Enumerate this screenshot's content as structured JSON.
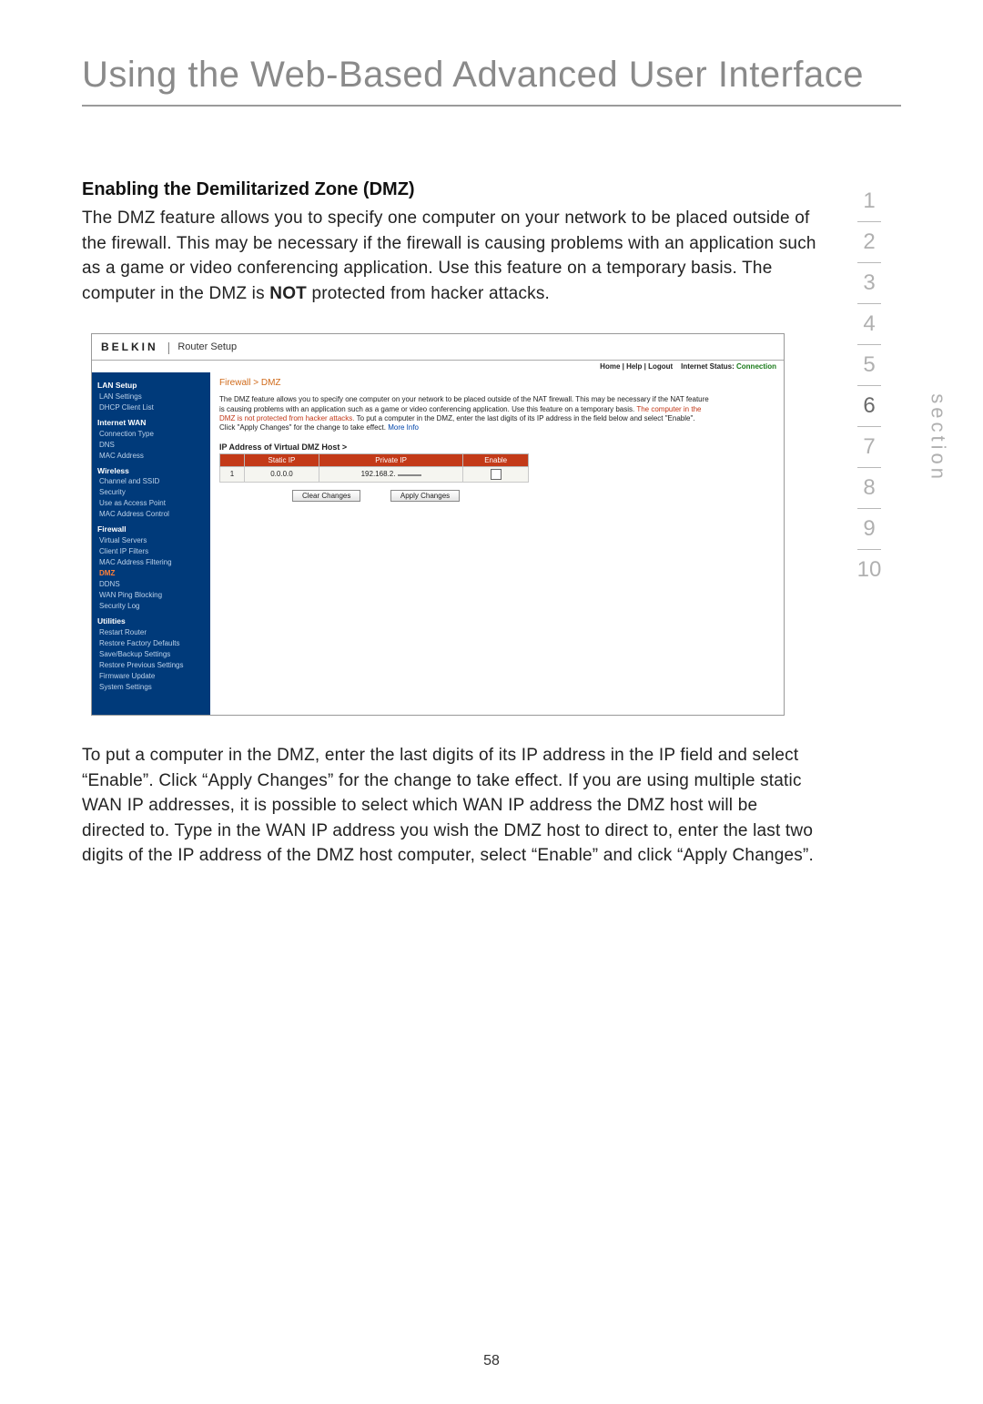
{
  "doc_title": "Using the Web-Based Advanced User Interface",
  "section_heading": "Enabling the Demilitarized Zone (DMZ)",
  "para1_pre": "The DMZ feature allows you to specify one computer on your network to be placed outside of the firewall. This may be necessary if the firewall is causing problems with an application such as a game or video conferencing application. Use this feature on a temporary basis. The computer in the DMZ is ",
  "para1_bold": "NOT",
  "para1_post": " protected from hacker attacks.",
  "para2": "To put a computer in the DMZ, enter the last digits of its IP address in the IP field and select “Enable”. Click “Apply Changes” for the change to take effect. If you are using multiple static WAN IP addresses, it is possible to select which WAN IP address the DMZ host will be directed to. Type in the WAN IP address you wish the DMZ host to direct to, enter the last two digits of the IP address of the DMZ host computer, select “Enable” and click “Apply Changes”.",
  "page_number": "58",
  "side_nav": {
    "numbers": [
      "1",
      "2",
      "3",
      "4",
      "5",
      "6",
      "7",
      "8",
      "9",
      "10"
    ],
    "active_index": 5,
    "label": "section"
  },
  "shot": {
    "brand": "BELKIN",
    "title": "Router Setup",
    "toplinks_left": "Home | Help | Logout",
    "toplinks_status_label": "Internet Status:",
    "toplinks_status_value": "Connection",
    "breadcrumb": "Firewall > DMZ",
    "desc_plain1": "The DMZ feature allows you to specify one computer on your network to be placed outside of the NAT firewall. This may be necessary if the NAT feature is causing problems with an application such as a game or video conferencing application. Use this feature on a temporary basis.",
    "desc_warn": "The computer in the DMZ is not protected from hacker attacks.",
    "desc_plain2": "To put a computer in the DMZ, enter the last digits of its IP address in the field below and select \"Enable\". Click \"Apply Changes\" for the change to take effect.",
    "desc_link": "More Info",
    "subhead": "IP Address of Virtual DMZ Host >",
    "table": {
      "headers": [
        "",
        "Static IP",
        "Private IP",
        "Enable"
      ],
      "row": {
        "num": "1",
        "static_ip": "0.0.0.0",
        "private_prefix": "192.168.2.",
        "private_last": ""
      }
    },
    "buttons": {
      "clear": "Clear Changes",
      "apply": "Apply Changes"
    },
    "nav": [
      {
        "type": "head",
        "label": "LAN Setup"
      },
      {
        "type": "item",
        "label": "LAN Settings"
      },
      {
        "type": "item",
        "label": "DHCP Client List"
      },
      {
        "type": "head",
        "label": "Internet WAN"
      },
      {
        "type": "item",
        "label": "Connection Type"
      },
      {
        "type": "item",
        "label": "DNS"
      },
      {
        "type": "item",
        "label": "MAC Address"
      },
      {
        "type": "head",
        "label": "Wireless"
      },
      {
        "type": "item",
        "label": "Channel and SSID"
      },
      {
        "type": "item",
        "label": "Security"
      },
      {
        "type": "item",
        "label": "Use as Access Point"
      },
      {
        "type": "item",
        "label": "MAC Address Control"
      },
      {
        "type": "head",
        "label": "Firewall",
        "hl": true
      },
      {
        "type": "item",
        "label": "Virtual Servers"
      },
      {
        "type": "item",
        "label": "Client IP Filters"
      },
      {
        "type": "item",
        "label": "MAC Address Filtering"
      },
      {
        "type": "item",
        "label": "DMZ",
        "hl": true
      },
      {
        "type": "item",
        "label": "DDNS"
      },
      {
        "type": "item",
        "label": "WAN Ping Blocking"
      },
      {
        "type": "item",
        "label": "Security Log"
      },
      {
        "type": "head",
        "label": "Utilities"
      },
      {
        "type": "item",
        "label": "Restart Router"
      },
      {
        "type": "item",
        "label": "Restore Factory Defaults"
      },
      {
        "type": "item",
        "label": "Save/Backup Settings"
      },
      {
        "type": "item",
        "label": "Restore Previous Settings"
      },
      {
        "type": "item",
        "label": "Firmware Update"
      },
      {
        "type": "item",
        "label": "System Settings"
      }
    ]
  }
}
